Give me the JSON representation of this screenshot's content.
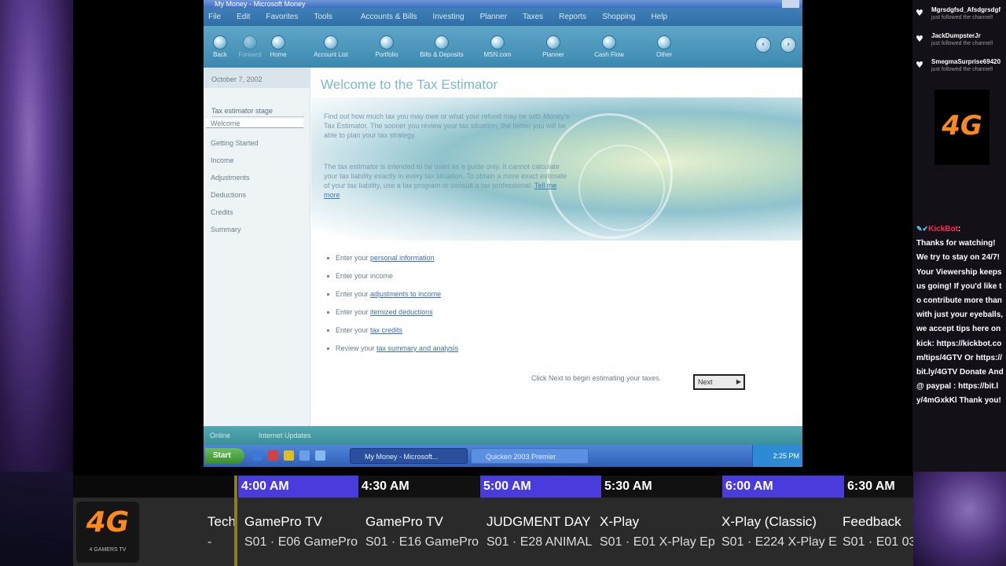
{
  "app": {
    "title": "My Money - Microsoft Money",
    "menu": [
      "File",
      "Edit",
      "Favorites",
      "Tools",
      "Accounts & Bills",
      "Investing",
      "Planner",
      "Taxes",
      "Reports",
      "Shopping",
      "Help"
    ],
    "toolbar": [
      "Back",
      "Forward",
      "Home",
      "Account List",
      "Portfolio",
      "Bills & Deposits",
      "MSN.com",
      "Planner",
      "Cash Flow",
      "Other"
    ],
    "date": "October 7, 2002",
    "stages_title": "Tax estimator stage",
    "stages": [
      "Welcome",
      "Getting Started",
      "Income",
      "Adjustments",
      "Deductions",
      "Credits",
      "Summary"
    ],
    "heading": "Welcome to the Tax Estimator",
    "intro1": "Find out how much tax you may owe or what your refund may be with Money's Tax Estimator. The sooner you review your tax situation, the better you will be able to plan your tax strategy.",
    "intro2": "The tax estimator is intended to be used as a guide only. It cannot calculate your tax liability exactly in every tax situation. To obtain a more exact estimate of your tax liability, use a tax program or consult a tax professional.",
    "intro2_link": "Tell me more",
    "steps": [
      {
        "prefix": "Enter your",
        "link": "personal information"
      },
      {
        "prefix": "Enter your income",
        "link": ""
      },
      {
        "prefix": "Enter your",
        "link": "adjustments to income"
      },
      {
        "prefix": "Enter your",
        "link": "itemized deductions"
      },
      {
        "prefix": "Enter your",
        "link": "tax credits"
      },
      {
        "prefix": "Review your",
        "link": "tax summary and analysis"
      }
    ],
    "next_hint": "Click Next to begin estimating your taxes.",
    "next_label": "Next",
    "status_left": "Online",
    "status_right": "Internet Updates",
    "start_label": "Start",
    "task_1": "My Money - Microsoft...",
    "task_2": "Quicken 2003 Premier",
    "clock": "2:25 PM"
  },
  "chat": {
    "followers": [
      {
        "name": "Mgrsdgfsd_Afsdgrsdgf",
        "action": "just followed the channel!"
      },
      {
        "name": "JackDumpsterJr",
        "action": "just followed the channel!"
      },
      {
        "name": "SmegmaSurprise69420",
        "action": "just followed the channel!"
      }
    ],
    "logo": "4G",
    "bot_name": "KickBot",
    "message": "Thanks for watching! We try to stay on 24/7! Your Viewership keeps us going! If you'd like to contribute more than with just your eyeballs, we accept tips here on kick: https://kickbot.com/tips/4GTV Or https://bit.ly/4GTV Donate And @ paypal : https://bit.ly/4mGxkKl Thank you!"
  },
  "guide": {
    "channel_logo": "4G",
    "channel_sub": "4 GAMERS TV",
    "times": [
      "4:00 AM",
      "4:30 AM",
      "5:00 AM",
      "5:30 AM",
      "6:00 AM",
      "6:30 AM"
    ],
    "programs": [
      {
        "title": "Tech",
        "sub": "-"
      },
      {
        "title": "GamePro TV",
        "sub": "S01 · E06 GamePro"
      },
      {
        "title": "GamePro TV",
        "sub": "S01 · E16 GamePro"
      },
      {
        "title": "JUDGMENT DAY",
        "sub": "S01 · E28 ANIMAL"
      },
      {
        "title": "X-Play",
        "sub": "S01 · E01 X-Play Ep"
      },
      {
        "title": "X-Play (Classic)",
        "sub": "S01 · E224 X-Play E"
      },
      {
        "title": "Feedback",
        "sub": "S01 · E01 03"
      }
    ]
  },
  "colors": {
    "guide_highlight": "#4a3cdc",
    "logo_orange": "#ff8a1c",
    "bot_name": "#ff2a4a"
  }
}
